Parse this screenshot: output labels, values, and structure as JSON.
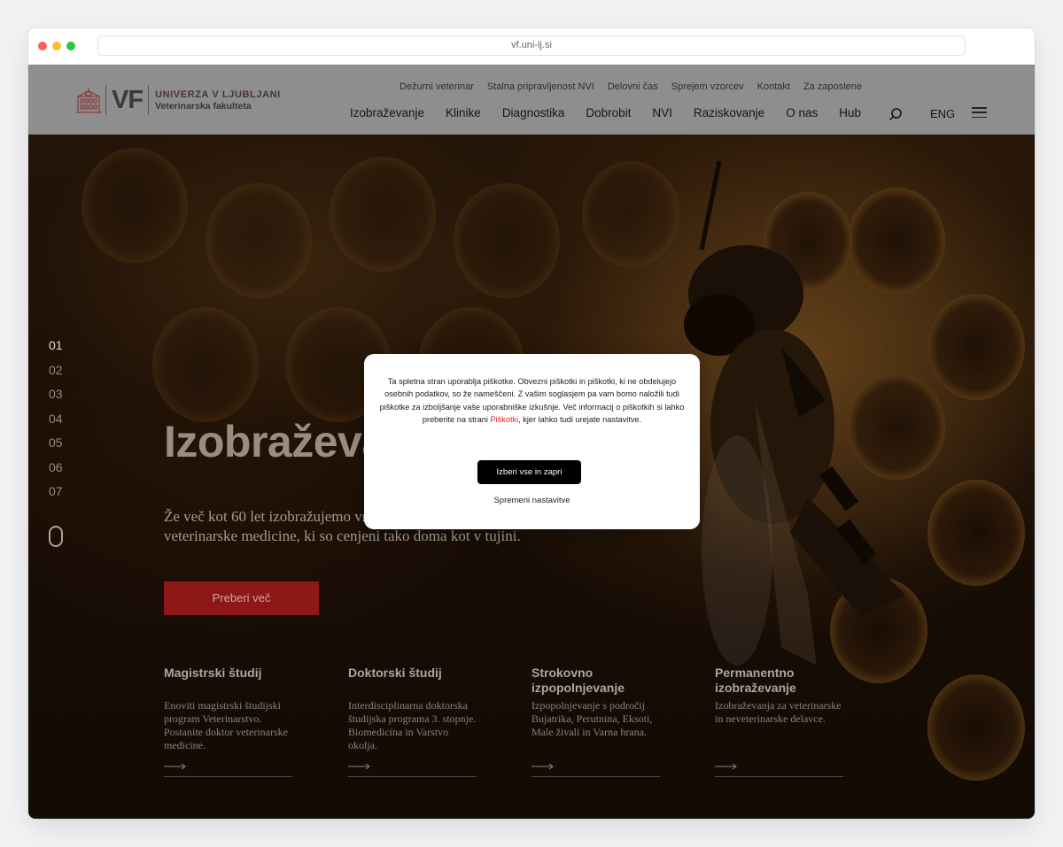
{
  "browser": {
    "url": "vf.uni-lj.si"
  },
  "header": {
    "logo": {
      "abbr": "VF",
      "university": "UNIVERZA V LJUBLJANI",
      "faculty": "Veterinarska fakulteta"
    },
    "top_links": [
      "Dežurni veterinar",
      "Stalna pripravljenost NVI",
      "Delovni čas",
      "Sprejem vzorcev",
      "Kontakt",
      "Za zaposlene"
    ],
    "main_nav": [
      "Izobraževanje",
      "Klinike",
      "Diagnostika",
      "Dobrobit",
      "NVI",
      "Raziskovanje",
      "O nas",
      "Hub"
    ],
    "lang": "ENG"
  },
  "hero": {
    "slides": [
      "01",
      "02",
      "03",
      "04",
      "05",
      "06",
      "07"
    ],
    "active_slide": "01",
    "title": "Izobraževanje",
    "description": "Že več kot 60 let izobražujemo vrhunske strokovnjake s področja veterinarske medicine, ki so cenjeni tako doma kot v tujini.",
    "button": "Preberi več"
  },
  "cards": [
    {
      "title": "Magistrski študij",
      "text": "Enoviti magistrski študijski program Veterinarstvo. Postanite doktor veterinarske medicine."
    },
    {
      "title": "Doktorski študij",
      "text": "Interdisciplinarna doktorska študijska programa 3. stopnje. Biomedicina in Varstvo okolja."
    },
    {
      "title": "Strokovno izpopolnjevanje",
      "text": "Izpopolnjevanje s področij Bujatrika, Perutnina, Eksoti, Male živali in Varna hrana."
    },
    {
      "title": "Permanentno izobraževanje",
      "text": "Izobraževanja za veterinarske in neveterinarske delavce."
    }
  ],
  "cookie_modal": {
    "text_before": "Ta spletna stran uporablja piškotke. Obvezni piškotki in piškotki, ki ne obdelujejo osebnih podatkov, so že nameščeni. Z vašim soglasjem pa vam bomo naložili tudi piškotke za izboljšanje vaše uporabniške izkušnje. Več informacij o piškotkih si lahko preberite na strani ",
    "link": "Piškotki",
    "text_after": ", kjer lahko tudi urejate nastavitve.",
    "accept": "Izberi vse in zapri",
    "settings": "Spremeni nastavitve"
  },
  "colors": {
    "accent_red": "#8e1818",
    "header_gray": "#8e8e8e",
    "link_red": "#d92a2a"
  }
}
